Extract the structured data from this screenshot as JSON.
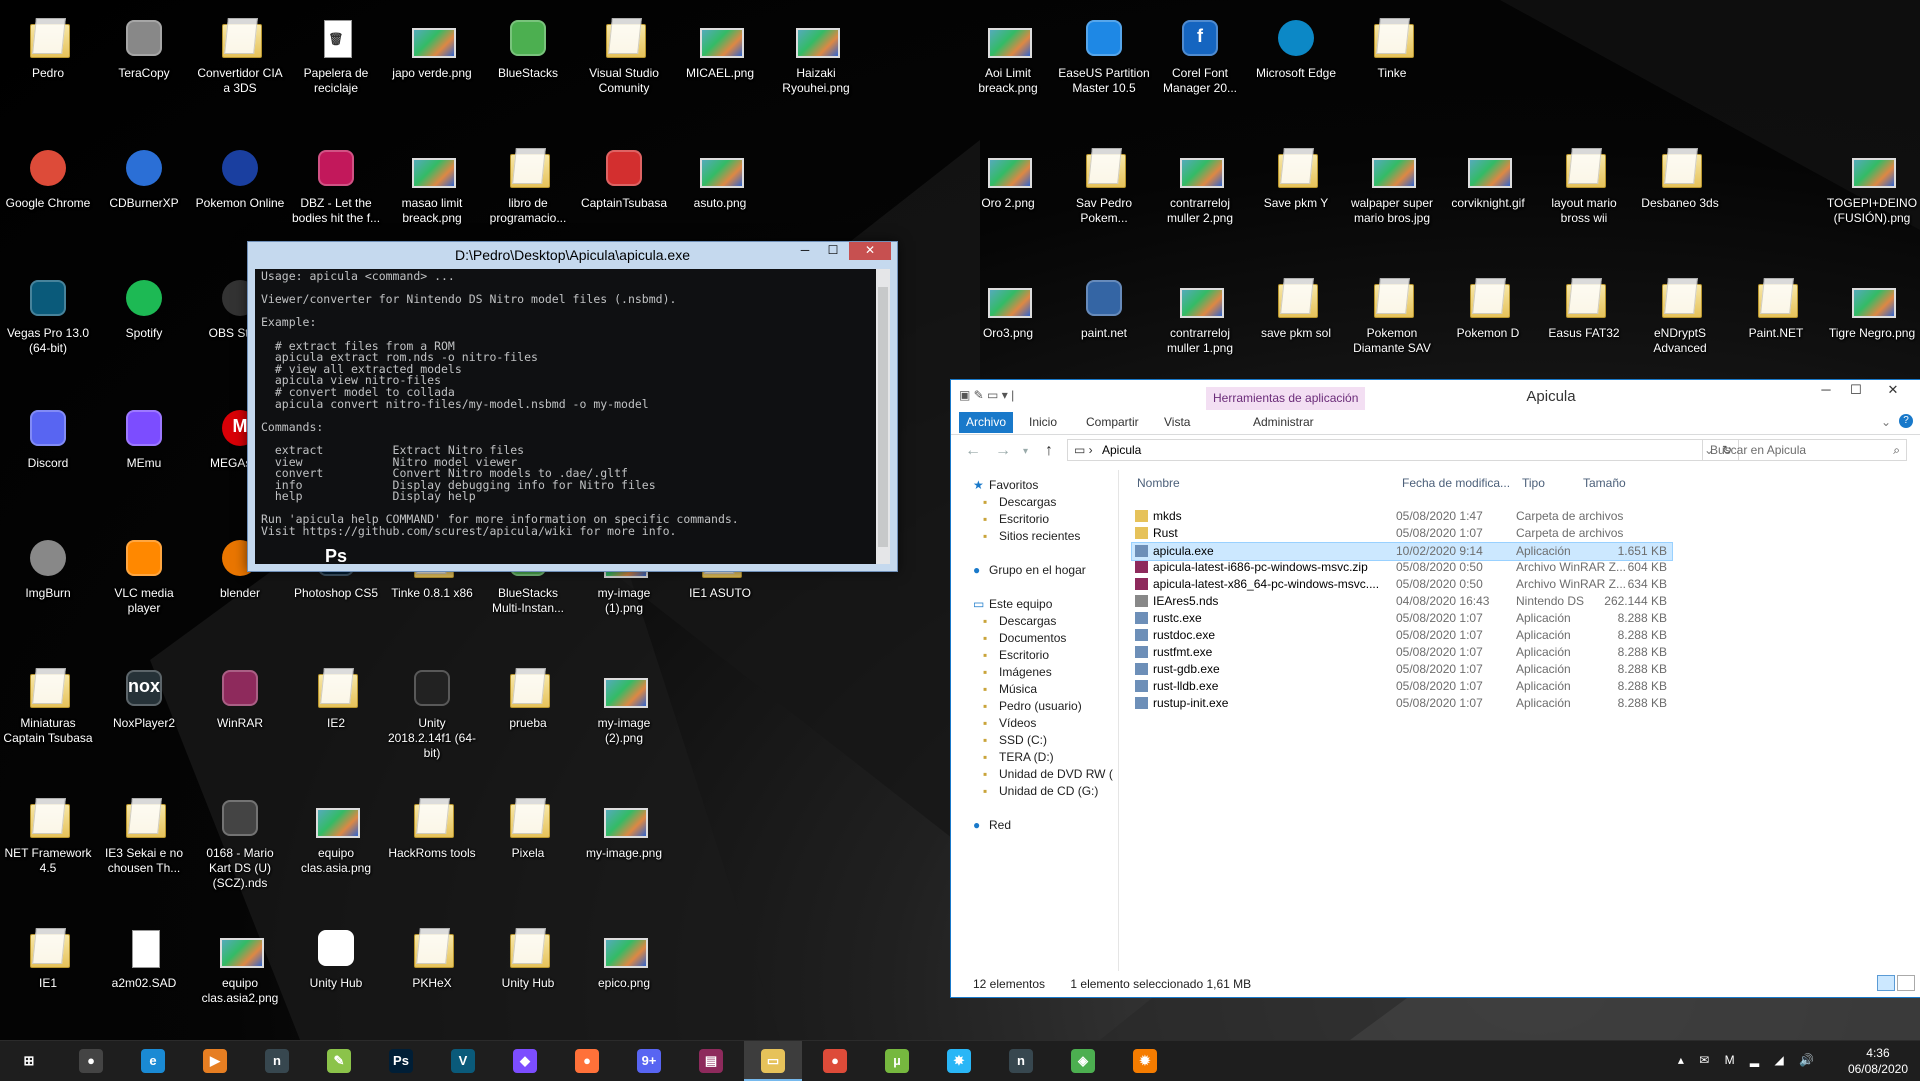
{
  "desktop": {
    "icons": [
      {
        "label": "Pedro",
        "type": "folder"
      },
      {
        "label": "TeraCopy",
        "type": "app",
        "color": "#888"
      },
      {
        "label": "Convertidor CIA a 3DS",
        "type": "folder"
      },
      {
        "label": "Papelera de reciclaje",
        "type": "file",
        "glyph": "🗑"
      },
      {
        "label": "japo verde.png",
        "type": "img"
      },
      {
        "label": "BlueStacks",
        "type": "app",
        "color": "#4caf50"
      },
      {
        "label": "Visual Studio Comunity",
        "type": "folder"
      },
      {
        "label": "MICAEL.png",
        "type": "img"
      },
      {
        "label": "Haizaki Ryouhei.png",
        "type": "img"
      },
      {
        "label": "Aoi Limit breack.png",
        "type": "img"
      },
      {
        "label": "EaseUS Partition Master 10.5",
        "type": "app",
        "color": "#1e88e5"
      },
      {
        "label": "Corel Font Manager 20...",
        "type": "app",
        "color": "#1565c0",
        "glyph": "f"
      },
      {
        "label": "Microsoft Edge",
        "type": "round",
        "color": "#0c88c6"
      },
      {
        "label": "Tinke",
        "type": "folder"
      },
      {
        "label": "Google Chrome",
        "type": "round",
        "color": "#dd4b39"
      },
      {
        "label": "CDBurnerXP",
        "type": "round",
        "color": "#2b6fd6"
      },
      {
        "label": "Pokemon Online",
        "type": "round",
        "color": "#1a3fa0"
      },
      {
        "label": "DBZ - Let the bodies hit the f...",
        "type": "app",
        "color": "#c2185b"
      },
      {
        "label": "masao limit breack.png",
        "type": "img"
      },
      {
        "label": "libro de programacio...",
        "type": "folder"
      },
      {
        "label": "CaptainTsubasa",
        "type": "app",
        "color": "#d32f2f"
      },
      {
        "label": "asuto.png",
        "type": "img"
      },
      {
        "label": "Oro 2.png",
        "type": "img"
      },
      {
        "label": "Sav Pedro Pokem...",
        "type": "folder"
      },
      {
        "label": "contrarreloj muller 2.png",
        "type": "img"
      },
      {
        "label": "Save pkm  Y",
        "type": "folder"
      },
      {
        "label": "walpaper super mario bros.jpg",
        "type": "img"
      },
      {
        "label": "corviknight.gif",
        "type": "img"
      },
      {
        "label": "layout mario bross wii",
        "type": "folder"
      },
      {
        "label": "Desbaneo 3ds",
        "type": "folder"
      },
      {
        "label": "TOGEPI+DEINO (FUSIÓN).png",
        "type": "img"
      },
      {
        "label": "Vegas Pro 13.0 (64-bit)",
        "type": "app",
        "color": "#0a5a7a"
      },
      {
        "label": "Spotify",
        "type": "round",
        "color": "#1db954"
      },
      {
        "label": "OBS Studio",
        "type": "round",
        "color": "#333"
      },
      {
        "label": "Oro3.png",
        "type": "img"
      },
      {
        "label": "paint.net",
        "type": "app",
        "color": "#3465a4"
      },
      {
        "label": "contrarreloj muller 1.png",
        "type": "img"
      },
      {
        "label": "save pkm sol",
        "type": "folder"
      },
      {
        "label": "Pokemon Diamante SAV",
        "type": "folder"
      },
      {
        "label": "Pokemon D",
        "type": "folder"
      },
      {
        "label": "Easus FAT32",
        "type": "folder"
      },
      {
        "label": "eNDryptS Advanced",
        "type": "folder"
      },
      {
        "label": "Paint.NET",
        "type": "folder"
      },
      {
        "label": "Tigre Negro.png",
        "type": "img"
      },
      {
        "label": "Discord",
        "type": "app",
        "color": "#5865f2"
      },
      {
        "label": "MEmu",
        "type": "app",
        "color": "#7c4dff"
      },
      {
        "label": "MEGAsync",
        "type": "round",
        "color": "#d90007",
        "glyph": "M"
      },
      {
        "label": "ImgBurn",
        "type": "round",
        "color": "#888"
      },
      {
        "label": "VLC media player",
        "type": "app",
        "color": "#ff8800"
      },
      {
        "label": "blender",
        "type": "round",
        "color": "#ea7600"
      },
      {
        "label": "Photoshop CS5",
        "type": "app",
        "color": "#001e36",
        "glyph": "Ps"
      },
      {
        "label": "Tinke 0.8.1 x86",
        "type": "folder"
      },
      {
        "label": "BlueStacks Multi-Instan...",
        "type": "app",
        "color": "#4caf50"
      },
      {
        "label": "my-image (1).png",
        "type": "img"
      },
      {
        "label": "IE1 ASUTO",
        "type": "folder"
      },
      {
        "label": "Miniaturas Captain Tsubasa",
        "type": "folder"
      },
      {
        "label": "NoxPlayer2",
        "type": "app",
        "color": "#263238",
        "glyph": "nox"
      },
      {
        "label": "WinRAR",
        "type": "app",
        "color": "#8e2a5c"
      },
      {
        "label": "IE2",
        "type": "folder"
      },
      {
        "label": "Unity 2018.2.14f1 (64-bit)",
        "type": "app",
        "color": "#222"
      },
      {
        "label": "prueba",
        "type": "folder"
      },
      {
        "label": "my-image (2).png",
        "type": "img"
      },
      {
        "label": "NET Framework 4.5",
        "type": "folder"
      },
      {
        "label": "IE3 Sekai e no chousen Th...",
        "type": "folder"
      },
      {
        "label": "0168 - Mario Kart DS (U)(SCZ).nds",
        "type": "app",
        "color": "#444"
      },
      {
        "label": "equipo clas.asia.png",
        "type": "img"
      },
      {
        "label": "HackRoms tools",
        "type": "folder"
      },
      {
        "label": "Pixela",
        "type": "folder"
      },
      {
        "label": "my-image.png",
        "type": "img"
      },
      {
        "label": "IE1",
        "type": "folder"
      },
      {
        "label": "a2m02.SAD",
        "type": "file"
      },
      {
        "label": "equipo clas.asia2.png",
        "type": "img"
      },
      {
        "label": "Unity Hub",
        "type": "app",
        "color": "#fff"
      },
      {
        "label": "PKHeX",
        "type": "folder"
      },
      {
        "label": "Unity Hub",
        "type": "folder"
      },
      {
        "label": "epico.png",
        "type": "img"
      }
    ]
  },
  "console": {
    "title": "D:\\Pedro\\Desktop\\Apicula\\apicula.exe",
    "text": "Usage: apicula <command> ...\n\nViewer/converter for Nintendo DS Nitro model files (.nsbmd).\n\nExample:\n\n  # extract files from a ROM\n  apicula extract rom.nds -o nitro-files\n  # view all extracted models\n  apicula view nitro-files\n  # convert model to collada\n  apicula convert nitro-files/my-model.nsbmd -o my-model\n\nCommands:\n\n  extract          Extract Nitro files\n  view             Nitro model viewer\n  convert          Convert Nitro models to .dae/.gltf\n  info             Display debugging info for Nitro files\n  help             Display help\n\nRun 'apicula help COMMAND' for more information on specific commands.\nVisit https://github.com/scurest/apicula/wiki for more info."
  },
  "explorer": {
    "title": "Apicula",
    "context_tab": "Herramientas de aplicación",
    "ribbon_tabs": [
      "Archivo",
      "Inicio",
      "Compartir",
      "Vista",
      "Administrar"
    ],
    "address": "Apicula",
    "search_placeholder": "Buscar en Apicula",
    "columns": {
      "name": "Nombre",
      "date": "Fecha de modifica...",
      "type": "Tipo",
      "size": "Tamaño"
    },
    "nav": [
      {
        "label": "Favoritos",
        "indent": 0
      },
      {
        "label": "Descargas",
        "indent": 1
      },
      {
        "label": "Escritorio",
        "indent": 1
      },
      {
        "label": "Sitios recientes",
        "indent": 1
      },
      {
        "label": "Grupo en el hogar",
        "indent": 0
      },
      {
        "label": "Este equipo",
        "indent": 0
      },
      {
        "label": "Descargas",
        "indent": 1
      },
      {
        "label": "Documentos",
        "indent": 1
      },
      {
        "label": "Escritorio",
        "indent": 1
      },
      {
        "label": "Imágenes",
        "indent": 1
      },
      {
        "label": "Música",
        "indent": 1
      },
      {
        "label": "Pedro (usuario)",
        "indent": 1
      },
      {
        "label": "Vídeos",
        "indent": 1
      },
      {
        "label": "SSD (C:)",
        "indent": 1
      },
      {
        "label": "TERA (D:)",
        "indent": 1
      },
      {
        "label": "Unidad de DVD RW (",
        "indent": 1
      },
      {
        "label": "Unidad de CD (G:)",
        "indent": 1
      },
      {
        "label": "Red",
        "indent": 0
      }
    ],
    "files": [
      {
        "name": "mkds",
        "date": "05/08/2020 1:47",
        "type": "Carpeta de archivos",
        "size": "",
        "kind": "folder"
      },
      {
        "name": "Rust",
        "date": "05/08/2020 1:07",
        "type": "Carpeta de archivos",
        "size": "",
        "kind": "folder"
      },
      {
        "name": "apicula.exe",
        "date": "10/02/2020 9:14",
        "type": "Aplicación",
        "size": "1.651 KB",
        "kind": "exe",
        "selected": true
      },
      {
        "name": "apicula-latest-i686-pc-windows-msvc.zip",
        "date": "05/08/2020 0:50",
        "type": "Archivo WinRAR Z...",
        "size": "604 KB",
        "kind": "rar"
      },
      {
        "name": "apicula-latest-x86_64-pc-windows-msvc....",
        "date": "05/08/2020 0:50",
        "type": "Archivo WinRAR Z...",
        "size": "634 KB",
        "kind": "rar"
      },
      {
        "name": "IEAres5.nds",
        "date": "04/08/2020 16:43",
        "type": "Nintendo DS",
        "size": "262.144 KB",
        "kind": "nds"
      },
      {
        "name": "rustc.exe",
        "date": "05/08/2020 1:07",
        "type": "Aplicación",
        "size": "8.288 KB",
        "kind": "exe"
      },
      {
        "name": "rustdoc.exe",
        "date": "05/08/2020 1:07",
        "type": "Aplicación",
        "size": "8.288 KB",
        "kind": "exe"
      },
      {
        "name": "rustfmt.exe",
        "date": "05/08/2020 1:07",
        "type": "Aplicación",
        "size": "8.288 KB",
        "kind": "exe"
      },
      {
        "name": "rust-gdb.exe",
        "date": "05/08/2020 1:07",
        "type": "Aplicación",
        "size": "8.288 KB",
        "kind": "exe"
      },
      {
        "name": "rust-lldb.exe",
        "date": "05/08/2020 1:07",
        "type": "Aplicación",
        "size": "8.288 KB",
        "kind": "exe"
      },
      {
        "name": "rustup-init.exe",
        "date": "05/08/2020 1:07",
        "type": "Aplicación",
        "size": "8.288 KB",
        "kind": "exe"
      }
    ],
    "status_count": "12 elementos",
    "status_selected": "1 elemento seleccionado  1,61 MB"
  },
  "taskbar": {
    "apps": [
      {
        "name": "start-button",
        "glyph": "⊞",
        "color": "#1e1e1e"
      },
      {
        "name": "obs",
        "glyph": "●",
        "color": "#444"
      },
      {
        "name": "internet-explorer",
        "glyph": "e",
        "color": "#1a8ad4"
      },
      {
        "name": "media-player",
        "glyph": "▶",
        "color": "#e67e22"
      },
      {
        "name": "nox",
        "glyph": "n",
        "color": "#37474f"
      },
      {
        "name": "paint",
        "glyph": "✎",
        "color": "#8bc34a"
      },
      {
        "name": "photoshop",
        "glyph": "Ps",
        "color": "#001e36"
      },
      {
        "name": "vegas",
        "glyph": "V",
        "color": "#0a5a7a"
      },
      {
        "name": "memu",
        "glyph": "◆",
        "color": "#7c4dff"
      },
      {
        "name": "firefox",
        "glyph": "●",
        "color": "#ff7139"
      },
      {
        "name": "discord",
        "glyph": "9+",
        "color": "#5865f2"
      },
      {
        "name": "winrar",
        "glyph": "▤",
        "color": "#8e2a5c"
      },
      {
        "name": "file-explorer",
        "glyph": "▭",
        "color": "#e6c25a",
        "active": true
      },
      {
        "name": "chrome",
        "glyph": "●",
        "color": "#dd4b39"
      },
      {
        "name": "utorrent",
        "glyph": "µ",
        "color": "#76b83f"
      },
      {
        "name": "pinwheel",
        "glyph": "✸",
        "color": "#29b6f6"
      },
      {
        "name": "nox-2",
        "glyph": "n",
        "color": "#37474f"
      },
      {
        "name": "bluestacks",
        "glyph": "◈",
        "color": "#4caf50"
      },
      {
        "name": "settings-app",
        "glyph": "✹",
        "color": "#f57c00"
      }
    ],
    "time": "4:36",
    "date": "06/08/2020"
  }
}
